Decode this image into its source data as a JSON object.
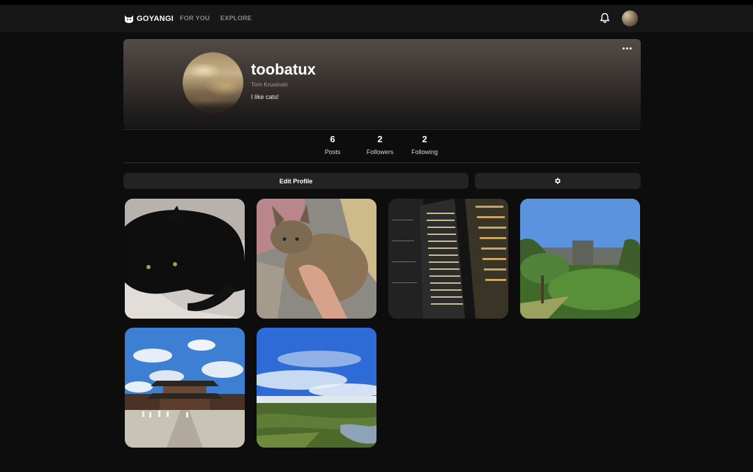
{
  "app": {
    "brand": "GOYANGI",
    "nav": [
      {
        "label": "FOR YOU"
      },
      {
        "label": "EXPLORE"
      }
    ]
  },
  "profile": {
    "username": "toobatux",
    "real_name": "Tom Krusinski",
    "bio": "I like cats!"
  },
  "stats": [
    {
      "value": "6",
      "label": "Posts"
    },
    {
      "value": "2",
      "label": "Followers"
    },
    {
      "value": "2",
      "label": "Following"
    }
  ],
  "actions": {
    "edit_profile": "Edit Profile"
  },
  "posts": [
    {
      "subject": "black-cat"
    },
    {
      "subject": "tabby-cat"
    },
    {
      "subject": "city-night"
    },
    {
      "subject": "garden-campus"
    },
    {
      "subject": "palace"
    },
    {
      "subject": "sky-marsh"
    }
  ],
  "icons": {
    "brand": "cat-icon",
    "notifications": "bell-icon",
    "more": "ellipsis-icon",
    "settings": "gear-icon"
  },
  "colors": {
    "background": "#0d0d0d",
    "navbar": "#171717",
    "button": "#232323",
    "muted_text": "#8a8a8a"
  }
}
